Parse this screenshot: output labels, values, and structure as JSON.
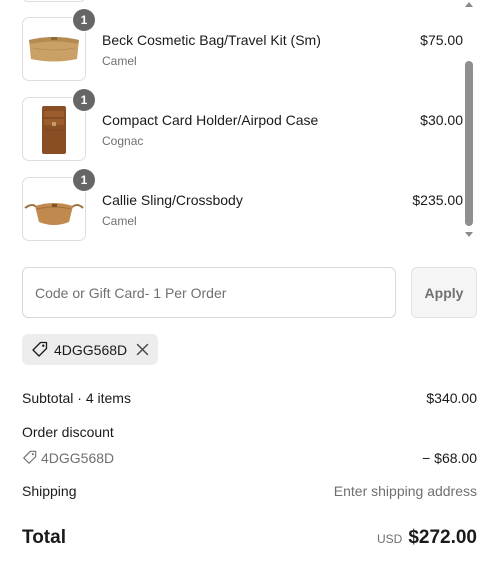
{
  "products": [
    {
      "title": "Beck Cosmetic Bag/Travel Kit (Sm)",
      "variant": "Camel",
      "price": "$75.00",
      "quantity": "1",
      "image_icon": "cosmetic-bag-image"
    },
    {
      "title": "Compact Card Holder/Airpod Case",
      "variant": "Cognac",
      "price": "$30.00",
      "quantity": "1",
      "image_icon": "card-holder-image"
    },
    {
      "title": "Callie Sling/Crossbody",
      "variant": "Camel",
      "price": "$235.00",
      "quantity": "1",
      "image_icon": "sling-bag-image"
    }
  ],
  "discount": {
    "placeholder": "Code or Gift Card- 1 Per Order",
    "value": "",
    "apply_label": "Apply",
    "applied_code": "4DGG568D"
  },
  "summary": {
    "subtotal_label": "Subtotal · 4 items",
    "subtotal_value": "$340.00",
    "discount_label": "Order discount",
    "discount_code": "4DGG568D",
    "discount_value": "− $68.00",
    "shipping_label": "Shipping",
    "shipping_value": "Enter shipping address",
    "total_label": "Total",
    "total_currency": "USD",
    "total_value": "$272.00"
  },
  "colors": {
    "badge": "#666666",
    "chip_background": "#ededed",
    "muted_text": "#707070",
    "border": "#d9d9d9"
  }
}
